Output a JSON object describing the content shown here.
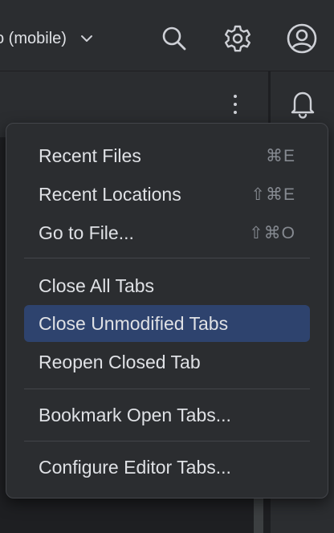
{
  "toolbar": {
    "config_label": "o (mobile)",
    "icons": [
      "chevron-down-icon",
      "search-icon",
      "gear-icon",
      "account-icon"
    ]
  },
  "editor": {
    "more_icon": "more-vertical-icon",
    "notifications_icon": "bell-icon"
  },
  "menu": {
    "items": [
      {
        "label": "Recent Files",
        "shortcut": "⌘E"
      },
      {
        "label": "Recent Locations",
        "shortcut": "⇧⌘E"
      },
      {
        "label": "Go to File...",
        "shortcut": "⇧⌘O"
      },
      {
        "label": "Close All Tabs",
        "shortcut": ""
      },
      {
        "label": "Close Unmodified Tabs",
        "shortcut": "",
        "selected": true
      },
      {
        "label": "Reopen Closed Tab",
        "shortcut": ""
      },
      {
        "label": "Bookmark Open Tabs...",
        "shortcut": ""
      },
      {
        "label": "Configure Editor Tabs...",
        "shortcut": ""
      }
    ]
  },
  "colors": {
    "background": "#1e1f22",
    "panel": "#2b2d30",
    "selection": "#2e436e",
    "text": "#dfe1e5",
    "shortcut_text": "#868a91"
  }
}
